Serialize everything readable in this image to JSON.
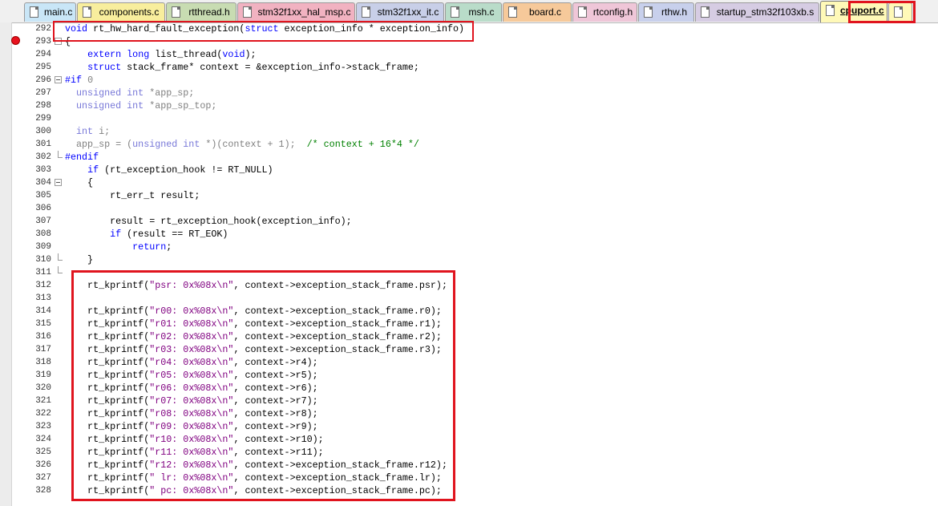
{
  "tabs": [
    {
      "label": "main.c",
      "color": "#c9e6f7"
    },
    {
      "label": "components.c",
      "color": "#f8ee9d"
    },
    {
      "label": "rtthread.h",
      "color": "#c8dcb2"
    },
    {
      "label": "stm32f1xx_hal_msp.c",
      "color": "#f1b2c1"
    },
    {
      "label": "stm32f1xx_it.c",
      "color": "#c8cfe8"
    },
    {
      "label": "msh.c",
      "color": "#b9dcc9"
    },
    {
      "label": "board.c",
      "color": "#f6c99a"
    },
    {
      "label": "rtconfig.h",
      "color": "#efc6d8"
    },
    {
      "label": "rthw.h",
      "color": "#c8d0ec"
    },
    {
      "label": "startup_stm32f103xb.s",
      "color": "#d6cce3"
    },
    {
      "label": "cpuport.c",
      "color": "#fff9b8",
      "active": true
    },
    {
      "label": "",
      "color": "#fff9b8"
    }
  ],
  "editor": {
    "breakpoint_line": "293",
    "lines": [
      {
        "num": "292",
        "text": "void rt_hw_hard_fault_exception(struct exception_info * exception_info)"
      },
      {
        "num": "293",
        "text": "{"
      },
      {
        "num": "294",
        "text": "    extern long list_thread(void);"
      },
      {
        "num": "295",
        "text": "    struct stack_frame* context = &exception_info->stack_frame;"
      },
      {
        "num": "296",
        "text": "#if 0"
      },
      {
        "num": "297",
        "text": "  unsigned int *app_sp;"
      },
      {
        "num": "298",
        "text": "  unsigned int *app_sp_top;"
      },
      {
        "num": "299",
        "text": ""
      },
      {
        "num": "300",
        "text": "  int i;"
      },
      {
        "num": "301",
        "text": "  app_sp = (unsigned int *)(context + 1);  /* context + 16*4 */"
      },
      {
        "num": "302",
        "text": "#endif"
      },
      {
        "num": "303",
        "text": "    if (rt_exception_hook != RT_NULL)"
      },
      {
        "num": "304",
        "text": "    {"
      },
      {
        "num": "305",
        "text": "        rt_err_t result;"
      },
      {
        "num": "306",
        "text": ""
      },
      {
        "num": "307",
        "text": "        result = rt_exception_hook(exception_info);"
      },
      {
        "num": "308",
        "text": "        if (result == RT_EOK)"
      },
      {
        "num": "309",
        "text": "            return;"
      },
      {
        "num": "310",
        "text": "    }"
      },
      {
        "num": "311",
        "text": ""
      },
      {
        "num": "312",
        "text": "    rt_kprintf(\"psr: 0x%08x\\n\", context->exception_stack_frame.psr);"
      },
      {
        "num": "313",
        "text": ""
      },
      {
        "num": "314",
        "text": "    rt_kprintf(\"r00: 0x%08x\\n\", context->exception_stack_frame.r0);"
      },
      {
        "num": "315",
        "text": "    rt_kprintf(\"r01: 0x%08x\\n\", context->exception_stack_frame.r1);"
      },
      {
        "num": "316",
        "text": "    rt_kprintf(\"r02: 0x%08x\\n\", context->exception_stack_frame.r2);"
      },
      {
        "num": "317",
        "text": "    rt_kprintf(\"r03: 0x%08x\\n\", context->exception_stack_frame.r3);"
      },
      {
        "num": "318",
        "text": "    rt_kprintf(\"r04: 0x%08x\\n\", context->r4);"
      },
      {
        "num": "319",
        "text": "    rt_kprintf(\"r05: 0x%08x\\n\", context->r5);"
      },
      {
        "num": "320",
        "text": "    rt_kprintf(\"r06: 0x%08x\\n\", context->r6);"
      },
      {
        "num": "321",
        "text": "    rt_kprintf(\"r07: 0x%08x\\n\", context->r7);"
      },
      {
        "num": "322",
        "text": "    rt_kprintf(\"r08: 0x%08x\\n\", context->r8);"
      },
      {
        "num": "323",
        "text": "    rt_kprintf(\"r09: 0x%08x\\n\", context->r9);"
      },
      {
        "num": "324",
        "text": "    rt_kprintf(\"r10: 0x%08x\\n\", context->r10);"
      },
      {
        "num": "325",
        "text": "    rt_kprintf(\"r11: 0x%08x\\n\", context->r11);"
      },
      {
        "num": "326",
        "text": "    rt_kprintf(\"r12: 0x%08x\\n\", context->exception_stack_frame.r12);"
      },
      {
        "num": "327",
        "text": "    rt_kprintf(\" lr: 0x%08x\\n\", context->exception_stack_frame.lr);"
      },
      {
        "num": "328",
        "text": "    rt_kprintf(\" pc: 0x%08x\\n\", context->exception_stack_frame.pc);"
      }
    ]
  },
  "colors": {
    "highlight_box": "#e0141e",
    "breakpoint": "#e8121e",
    "keyword": "#0000ff",
    "string": "#800080",
    "comment": "#008000"
  }
}
